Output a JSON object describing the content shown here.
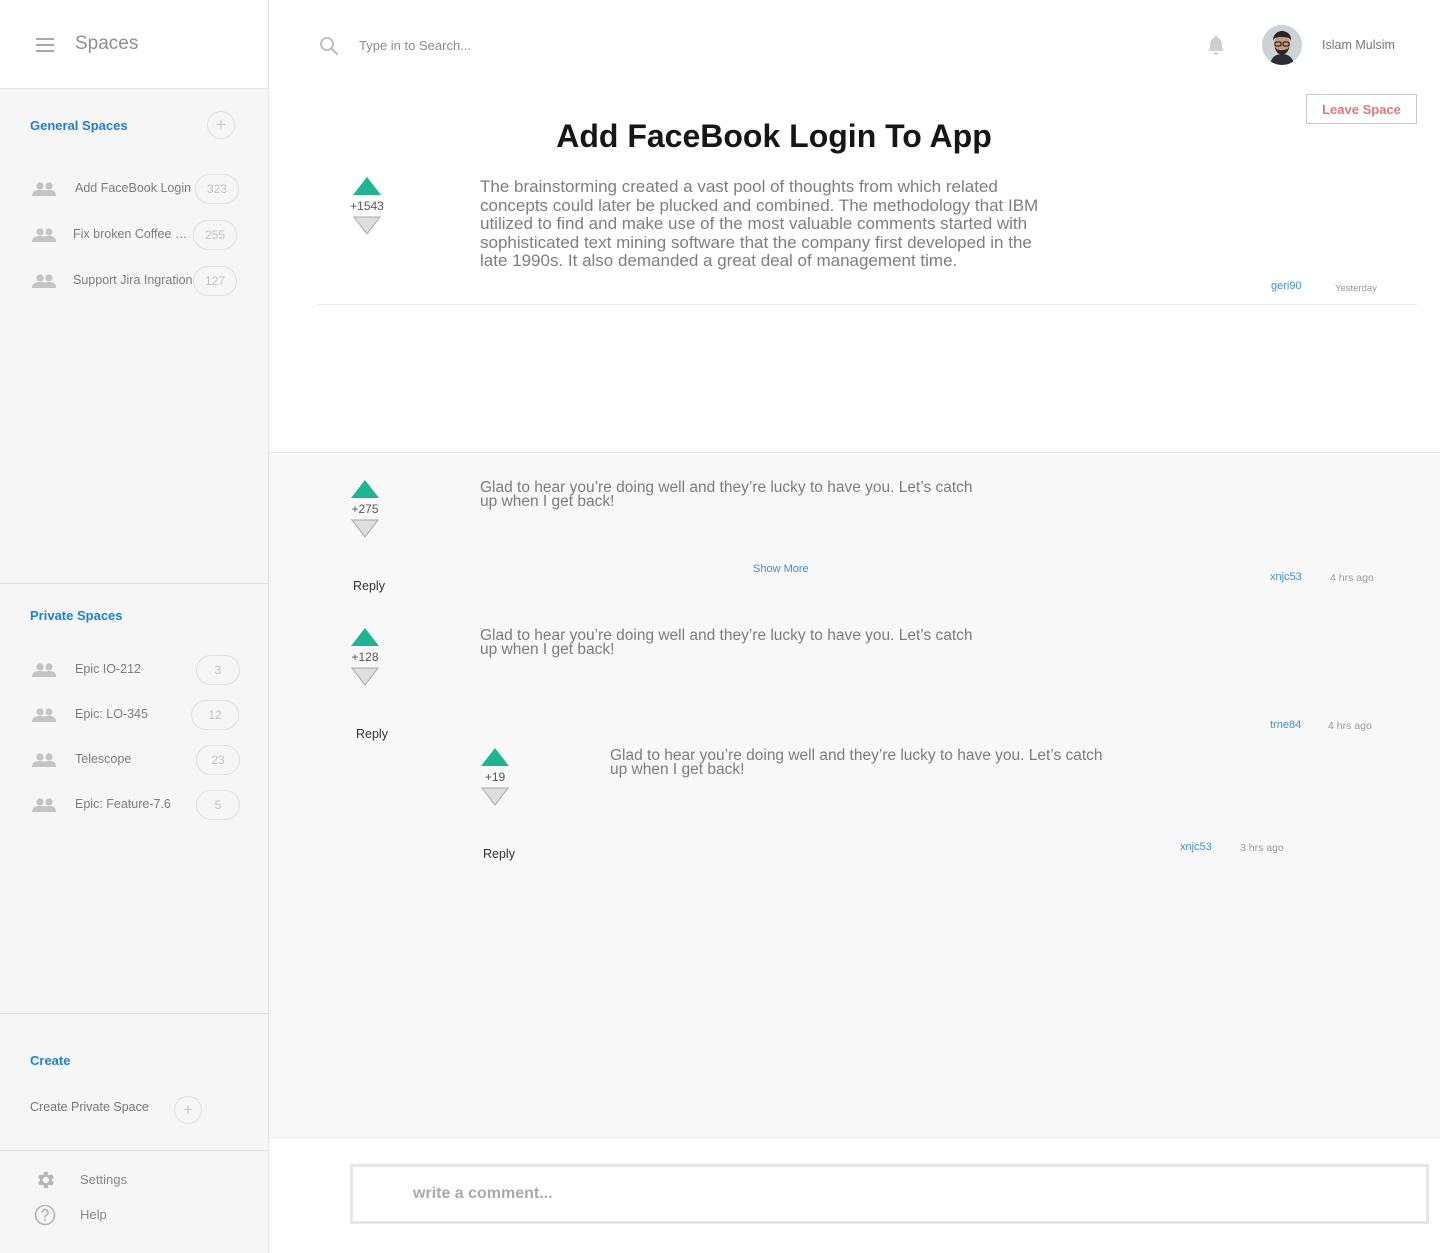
{
  "sidebar": {
    "title": "Spaces",
    "general": {
      "title": "General Spaces",
      "add_symbol": "+",
      "items": [
        {
          "label": "Add FaceBook Login",
          "count": "323"
        },
        {
          "label": "Fix broken Coffee o...",
          "count": "255"
        },
        {
          "label": "Support Jira Ingration",
          "count": "127"
        }
      ]
    },
    "private": {
      "title": "Private Spaces",
      "items": [
        {
          "label": "Epic IO-212",
          "count": "3"
        },
        {
          "label": "Epic: LO-345",
          "count": "12"
        },
        {
          "label": "Telescope",
          "count": "23"
        },
        {
          "label": "Epic: Feature-7.6",
          "count": "5"
        }
      ]
    },
    "create": {
      "title": "Create",
      "item_label": "Create Private Space",
      "add_symbol": "+"
    },
    "footer": {
      "settings": "Settings",
      "help": "Help"
    }
  },
  "topbar": {
    "search_placeholder": "Type in to Search...",
    "user_name": "Islam Mulsim"
  },
  "post": {
    "title": "Add FaceBook Login To App",
    "leave_label": "Leave Space",
    "score": "+1543",
    "body": "The brainstorming created a vast pool of thoughts from which related concepts could later be plucked and combined. The methodology that IBM utilized to find and make use of the most valuable comments started with sophisticated text mining software that the company first developed in the late 1990s. It also demanded a great deal of management time.",
    "author": "geri90",
    "time": "Yesterday"
  },
  "comments": [
    {
      "score": "+275",
      "text": "Glad to hear you’re doing well and they’re lucky to have you. Let’s catch up when I get back!",
      "reply": "Reply",
      "show_more": "Show More",
      "author": "xnjc53",
      "time": "4 hrs ago"
    },
    {
      "score": "+128",
      "text": "Glad to hear you’re doing well and they’re lucky to have you. Let’s catch up when I get back!",
      "reply": "Reply",
      "author": "trne84",
      "time": "4 hrs ago",
      "replies": [
        {
          "score": "+19",
          "text": "Glad to hear you’re doing well and they’re lucky to have you. Let’s catch up when I get back!",
          "reply": "Reply",
          "author": "xnjc53",
          "time": "3 hrs ago"
        }
      ]
    }
  ],
  "composer": {
    "placeholder": "write a comment..."
  },
  "colors": {
    "accent": "#1f7fd0",
    "upvote": "#1fb592",
    "danger": "#e07a7a",
    "link": "#3f8fd3"
  }
}
